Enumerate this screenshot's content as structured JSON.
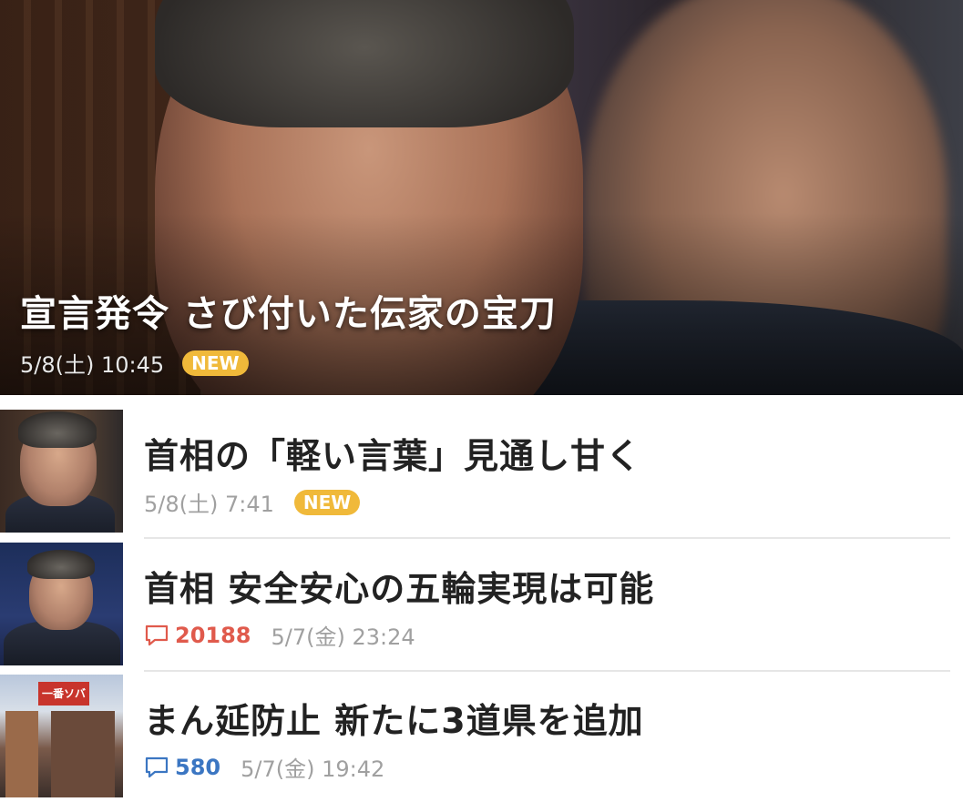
{
  "hero": {
    "title": "宣言発令 さび付いた伝家の宝刀",
    "time": "5/8(土) 10:45",
    "badge": "NEW"
  },
  "items": [
    {
      "title": "首相の「軽い言葉」見通し甘く",
      "time": "5/8(土) 7:41",
      "badge": "NEW",
      "comment_count": ""
    },
    {
      "title": "首相 安全安心の五輪実現は可能",
      "time": "5/7(金) 23:24",
      "badge": "",
      "comment_count": "20188"
    },
    {
      "title": "まん延防止 新たに3道県を追加",
      "time": "5/7(金) 19:42",
      "badge": "",
      "comment_count": "580"
    }
  ],
  "colors": {
    "badge_new": "#f0b93a",
    "comment_hot": "#e05a4c",
    "comment_cool": "#3b76c2",
    "meta_text": "#a0a0a0"
  },
  "icons": {
    "comment": "speech-bubble-icon"
  },
  "thumb_sign": "一番ソバ"
}
